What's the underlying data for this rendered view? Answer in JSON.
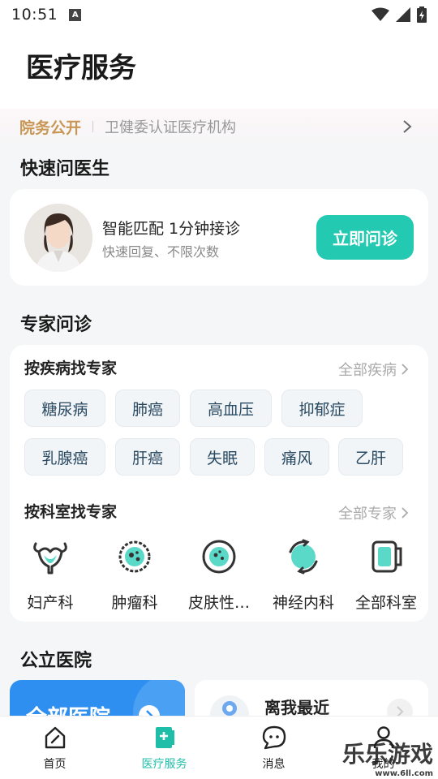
{
  "status_bar": {
    "time": "10:51",
    "notification_letter": "A"
  },
  "header": {
    "title": "医疗服务"
  },
  "notice": {
    "tag": "院务公开",
    "text": "卫健委认证医疗机构"
  },
  "quick_consult": {
    "section_title": "快速问医生",
    "title": "智能匹配 1分钟接诊",
    "subtitle": "快速回复、不限次数",
    "button_label": "立即问诊"
  },
  "expert": {
    "section_title": "专家问诊",
    "by_disease_title": "按疾病找专家",
    "all_diseases_link": "全部疾病",
    "diseases": [
      "糖尿病",
      "肺癌",
      "高血压",
      "抑郁症",
      "乳腺癌",
      "肝癌",
      "失眠",
      "痛风",
      "乙肝"
    ],
    "by_department_title": "按科室找专家",
    "all_experts_link": "全部专家",
    "departments": [
      {
        "label": "妇产科",
        "icon": "uterus-icon"
      },
      {
        "label": "肿瘤科",
        "icon": "tumor-cell-icon"
      },
      {
        "label": "皮肤性…",
        "icon": "skin-cell-icon"
      },
      {
        "label": "神经内科",
        "icon": "neuro-icon"
      },
      {
        "label": "全部科室",
        "icon": "all-departments-icon"
      }
    ]
  },
  "hospital": {
    "section_title": "公立医院",
    "all_hospitals_label": "全部医院",
    "nearby_title": "离我最近"
  },
  "bottom_nav": {
    "items": [
      {
        "label": "首页",
        "icon": "home-icon"
      },
      {
        "label": "医疗服务",
        "icon": "medical-service-icon"
      },
      {
        "label": "消息",
        "icon": "message-icon"
      },
      {
        "label": "我的",
        "icon": "profile-icon"
      }
    ]
  },
  "watermark": {
    "text": "乐乐游戏",
    "url": "www.6ll.com"
  },
  "colors": {
    "accent": "#23c9b0",
    "gold": "#c99654",
    "blue": "#2f8ff0"
  }
}
